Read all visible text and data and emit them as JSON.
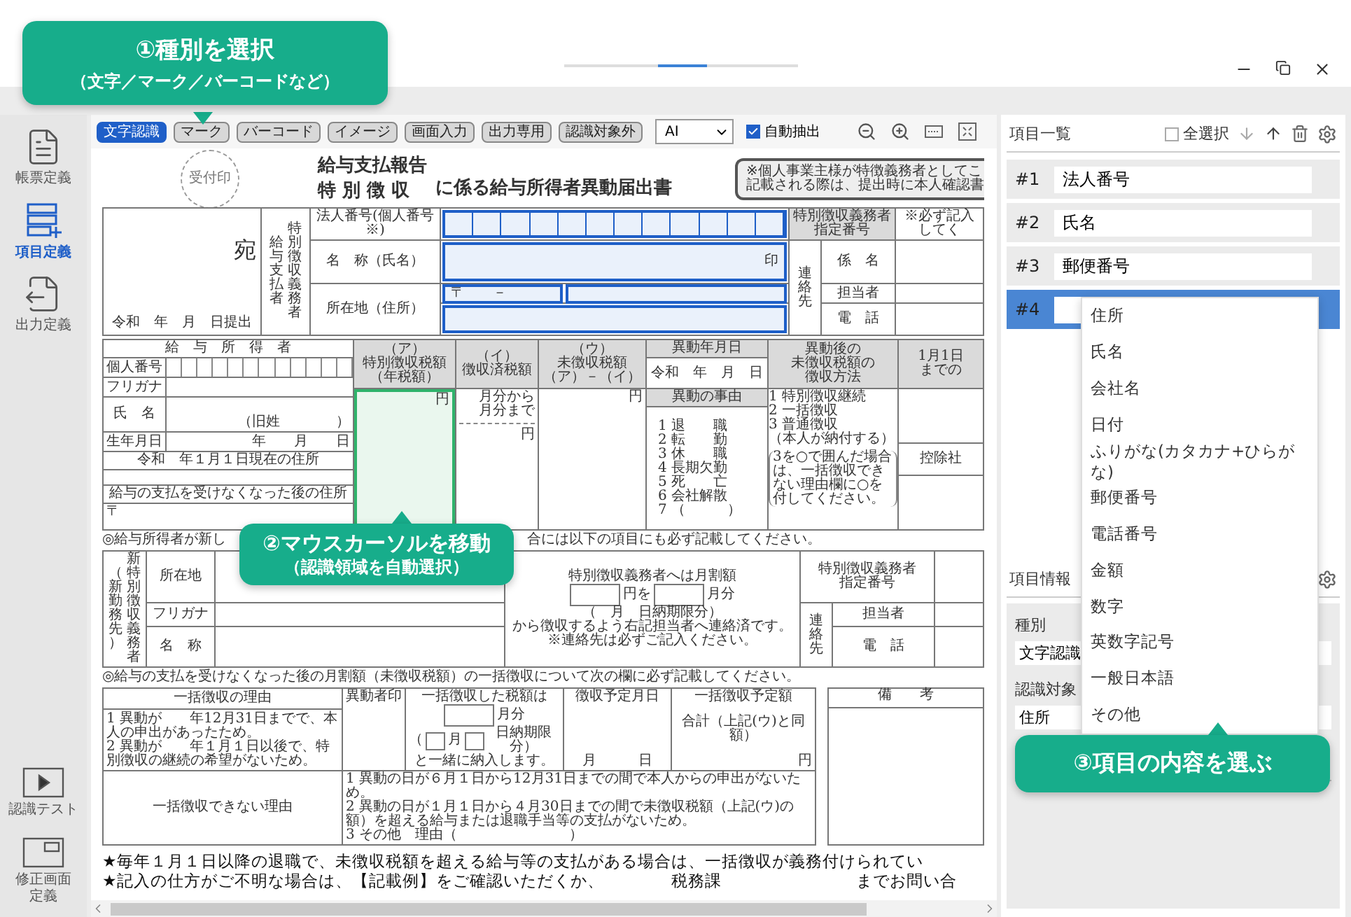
{
  "callouts": [
    {
      "title": "①種別を選択",
      "subtitle": "（文字／マーク／バーコードなど）"
    },
    {
      "title": "②マウスカーソルを移動",
      "subtitle": "（認識領域を自動選択）"
    },
    {
      "title": "③項目の内容を選ぶ"
    }
  ],
  "sidebar": {
    "items": [
      {
        "label": "帳票定義",
        "kind": "form",
        "selected": false
      },
      {
        "label": "項目定義",
        "kind": "fields",
        "selected": true
      },
      {
        "label": "出力定義",
        "kind": "output",
        "selected": false
      }
    ],
    "tools": [
      {
        "label": "認識テスト",
        "kind": "test"
      },
      {
        "label": "修正画面定義",
        "kind": "screen"
      }
    ]
  },
  "toolbar": {
    "type_buttons": [
      {
        "label": "文字認識",
        "selected": true
      },
      {
        "label": "マーク",
        "selected": false
      },
      {
        "label": "バーコード",
        "selected": false
      },
      {
        "label": "イメージ",
        "selected": false
      },
      {
        "label": "画面入力",
        "selected": false
      },
      {
        "label": "出力専用",
        "selected": false
      },
      {
        "label": "認識対象外",
        "selected": false
      }
    ],
    "engine_select": {
      "value": "AI"
    },
    "auto_extract": {
      "label": "自動抽出",
      "checked": true
    }
  },
  "document": {
    "stamp": "受付印",
    "title_lines": [
      "給与支払報告",
      "特 別 徴 収"
    ],
    "title_suffix": "に係る給与所得者異動届出書",
    "notice_lines": [
      "※個人事業主様が特徴義務者としてこ",
      "記載される際は、提出時に本人確認書"
    ],
    "payer": {
      "addressee": "宛",
      "submitted": "令和　年　月　日提出",
      "vertical_labels": [
        "給与支払者",
        "特別徴収義務者"
      ],
      "labels": [
        "法人番号(個人番号※)",
        "名　称（氏名）",
        "所在地（住所）"
      ],
      "seal": "印",
      "postal": "〒　　－",
      "id_label_lines": [
        "特別徴収義務者",
        "指定番号"
      ],
      "contact_label": "連絡先",
      "contact_fields": [
        "係　名",
        "担当者",
        "電　話"
      ],
      "note": "※必ず記入してく"
    },
    "employee": {
      "heading": "給　与　所　得　者",
      "labels": [
        "個人番号",
        "フリガナ",
        "氏　名",
        "生年月日"
      ],
      "maiden_name": "（旧姓　　　　）",
      "birth_date": "年　　月　　日",
      "address_label": "令和　年１月１日現在の住所",
      "later_address_label": "給与の支払を受けなくなった後の住所",
      "postal": "〒"
    },
    "tax_columns": [
      {
        "heading_lines": [
          "（ア）",
          "特別徴収税額",
          "（年税額）"
        ],
        "unit": "円"
      },
      {
        "heading_lines": [
          "（イ）",
          "徴収済税額"
        ],
        "months": [
          "月分から",
          "月分まで"
        ],
        "unit": "円"
      },
      {
        "heading_lines": [
          "（ウ）",
          "未徴収税額",
          "（ア）－（イ）"
        ],
        "unit": "円"
      }
    ],
    "change": {
      "date_heading": "異動年月日",
      "date": "令和　年　月　日",
      "reason_heading": "異動の事由",
      "reasons": [
        "1 退　　職",
        "2 転　　勤",
        "3 休　　職",
        "4 長期欠勤",
        "5 死　　亡",
        "6 会社解散",
        "7 （　　　）"
      ]
    },
    "collection": {
      "heading_lines": [
        "異動後の",
        "未徴収税額の",
        "徴収方法"
      ],
      "options": [
        "1 特別徴収継続",
        "2 一括徴収",
        "3 普通徴収"
      ],
      "option_note": "（本人が納付する）",
      "note": "3を○で囲んだ場合は、一括徴収できない理由欄に○を付してください。"
    },
    "cut_column": {
      "heading_lines": [
        "1月1日",
        "までの"
      ],
      "text": "控除社"
    },
    "new_employer_notice": [
      "◎給与所得者が新し",
      "合には以下の項目にも必ず記載してください。"
    ],
    "new_employer": {
      "vertical_labels": [
        "（新勤務先）",
        "新特別徴収義務者"
      ],
      "labels": [
        "所在地",
        "フリガナ",
        "名　称"
      ],
      "monthly_heading": "特別徴収義務者へは月割額",
      "yen_from": "円を",
      "month": "月分",
      "due": "（　月　日納期限分）",
      "contacted": "から徴収するよう右記担当者へ連絡済です。",
      "contact_note": "※連絡先は必ずご記入ください。",
      "id_label_lines": [
        "特別徴収義務者",
        "指定番号"
      ],
      "contact_label": "連絡先",
      "contact_fields": [
        "担当者",
        "電　話"
      ]
    },
    "lump_sum_notice": "◎給与の支払を受けなくなった後の月割額（未徴収税額）の一括徴収について次の欄に必ず記載してください。",
    "lump_sum": {
      "reason_heading": "一括徴収の理由",
      "reasons": [
        "1 異動が　　年12月31日までで、本人の申出があったため。",
        "2 異動が　　年１月１日以後で、特別徴収の継続の希望がないため。"
      ],
      "seal_heading": "異動者印",
      "paid_heading": "一括徴収した税額は",
      "paid_month": "月分",
      "paid_due_parts": [
        "（",
        "月",
        "日納期限分）"
      ],
      "paid_with": "と一緒に納入します。",
      "date_heading": "徴収予定月日",
      "date": "月　　　日",
      "amount_heading": "一括徴収予定額",
      "amount_sub": "合計（上記(ウ)と同額）",
      "amount_unit": "円",
      "unable_heading": "一括徴収できない理由",
      "unable_reasons": [
        "1 異動の日が６月１日から12月31日までの間で本人からの申出がないため。",
        "2 異動の日が１月１日から４月30日までの間で未徴収税額（上記(ウ)の額）を超える給与または退職手当等の支払がないため。",
        "3 その他　理由（　　　　　　　　）"
      ],
      "remarks_heading": "備　　考"
    },
    "footer_line": "★毎年１月１日以降の退職で、未徴収税額を超える給与等の支払がある場合は、一括徴収が義務付けられてい",
    "footer_parts": [
      "★記入の仕方がご不明な場合は、【記載例】をご確認いただくか、",
      "税務課",
      "までお問い合"
    ]
  },
  "item_list": {
    "title": "項目一覧",
    "select_all": {
      "label": "全選択",
      "checked": false
    },
    "items": [
      {
        "number": "#1",
        "value": "法人番号",
        "selected": false
      },
      {
        "number": "#2",
        "value": "氏名",
        "selected": false
      },
      {
        "number": "#3",
        "value": "郵便番号",
        "selected": false
      },
      {
        "number": "#4",
        "selected": true
      }
    ]
  },
  "dropdown": {
    "options": [
      "住所",
      "氏名",
      "会社名",
      "日付",
      "ふりがな(カタカナ+ひらがな)",
      "郵便番号",
      "電話番号",
      "金額",
      "数字",
      "英数字記号",
      "一般日本語",
      "その他"
    ]
  },
  "item_info": {
    "title": "項目情報",
    "fields": [
      {
        "label": "種別",
        "value": "文字認識"
      },
      {
        "label": "認識対象",
        "value": "住所"
      }
    ]
  }
}
